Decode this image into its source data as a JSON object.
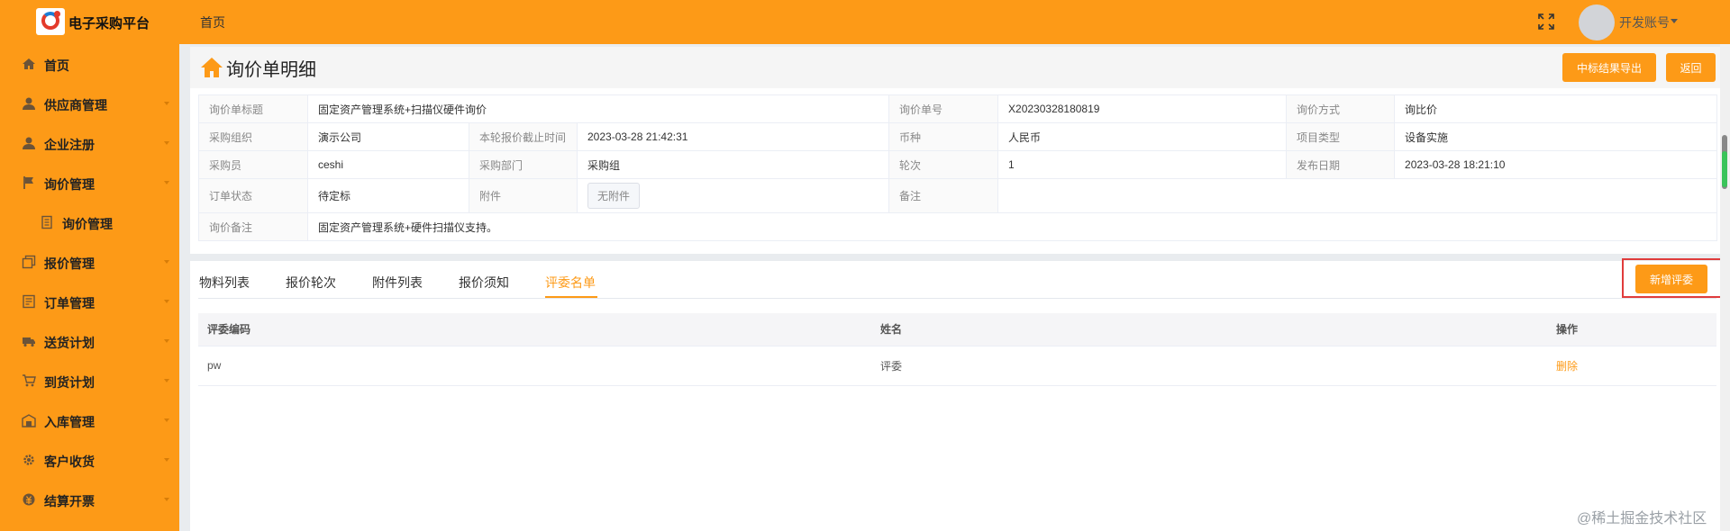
{
  "app": {
    "title": "电子采购平台",
    "top_home": "首页",
    "account": "开发账号"
  },
  "sidebar": {
    "items": [
      {
        "label": "首页",
        "icon": "home-icon"
      },
      {
        "label": "供应商管理",
        "icon": "user-icon"
      },
      {
        "label": "企业注册",
        "icon": "user-icon"
      },
      {
        "label": "询价管理",
        "icon": "flag-icon"
      },
      {
        "label": "询价管理",
        "icon": "document-icon"
      },
      {
        "label": "报价管理",
        "icon": "copy-icon"
      },
      {
        "label": "订单管理",
        "icon": "list-icon"
      },
      {
        "label": "送货计划",
        "icon": "truck-icon"
      },
      {
        "label": "到货计划",
        "icon": "cart-icon"
      },
      {
        "label": "入库管理",
        "icon": "warehouse-icon"
      },
      {
        "label": "客户收货",
        "icon": "gear-icon"
      },
      {
        "label": "结算开票",
        "icon": "money-icon"
      }
    ]
  },
  "page": {
    "title": "询价单明细",
    "export_label": "中标结果导出",
    "back_label": "返回"
  },
  "info": {
    "r1": {
      "l1": "询价单标题",
      "v1": "固定资产管理系统+扫描仪硬件询价",
      "l2": "询价单号",
      "v2": "X20230328180819",
      "l3": "询价方式",
      "v3": "询比价"
    },
    "r2": {
      "l1": "采购组织",
      "v1": "演示公司",
      "l2": "本轮报价截止时间",
      "v2": "2023-03-28 21:42:31",
      "l3": "币种",
      "v3": "人民币",
      "l4": "项目类型",
      "v4": "设备实施"
    },
    "r3": {
      "l1": "采购员",
      "v1": "ceshi",
      "l2": "采购部门",
      "v2": "采购组",
      "l3": "轮次",
      "v3": "1",
      "l4": "发布日期",
      "v4": "2023-03-28 18:21:10"
    },
    "r4": {
      "l1": "订单状态",
      "v1": "待定标",
      "l2": "附件",
      "v2": "无附件",
      "l3": "备注",
      "v3": ""
    },
    "r5": {
      "l1": "询价备注",
      "v1": "固定资产管理系统+硬件扫描仪支持。"
    }
  },
  "tabs": {
    "items": [
      "物料列表",
      "报价轮次",
      "附件列表",
      "报价须知",
      "评委名单"
    ],
    "active": 4,
    "add_label": "新增评委"
  },
  "grid": {
    "headers": [
      "评委编码",
      "姓名",
      "操作"
    ],
    "rows": [
      {
        "code": "pw",
        "name": "评委",
        "action": "删除"
      }
    ]
  },
  "watermark": "@稀土掘金技术社区",
  "colors": {
    "brand": "#fd9a17",
    "highlight": "#e03c3c"
  }
}
